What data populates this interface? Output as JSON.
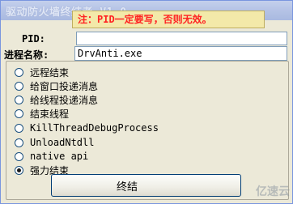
{
  "window": {
    "title": "驱动防火墙终结者 V1.0",
    "notice": "注：PID一定要写，否则无效。"
  },
  "form": {
    "pid_label": "PID:",
    "pid_value": "",
    "process_label": "进程名称:",
    "process_value": "DrvAnti.exe"
  },
  "options": [
    {
      "label": "远程结束",
      "checked": false
    },
    {
      "label": "给窗口投递消息",
      "checked": false
    },
    {
      "label": "给线程投递消息",
      "checked": false
    },
    {
      "label": "结束线程",
      "checked": false
    },
    {
      "label": "KillThreadDebugProcess",
      "checked": false
    },
    {
      "label": "UnloadNtdll",
      "checked": false
    },
    {
      "label": "native api",
      "checked": false
    },
    {
      "label": "强力结束",
      "checked": true
    }
  ],
  "actions": {
    "end_label": "终结"
  },
  "watermark": {
    "text": "亿速云"
  }
}
